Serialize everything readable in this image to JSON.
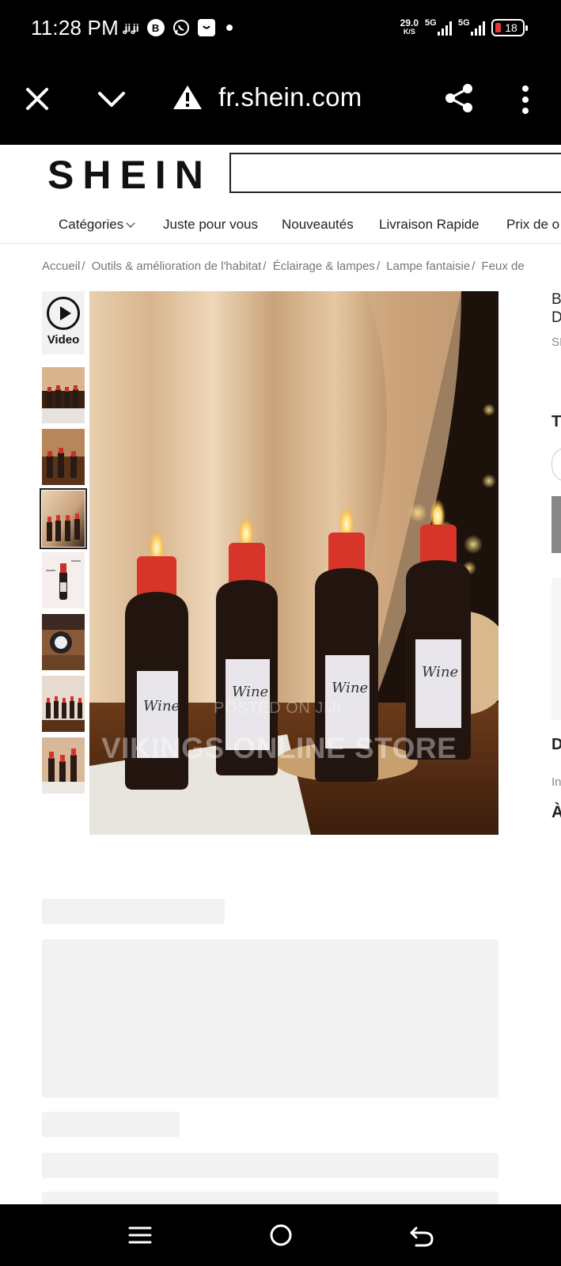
{
  "status_bar": {
    "time": "11:28 PM",
    "net_speed": "29.0",
    "net_unit": "K/S",
    "sim1": "5G",
    "sim2": "5G",
    "battery": "18"
  },
  "browser": {
    "url": "fr.shein.com",
    "icons": [
      "close-icon",
      "chevron-down-icon",
      "warning-icon",
      "share-icon",
      "more-vert-icon"
    ]
  },
  "site": {
    "logo": "SHEIN",
    "search_placeholder": ""
  },
  "nav": {
    "items": [
      "Catégories",
      "Juste pour vous",
      "Nouveautés",
      "Livraison Rapide",
      "Prix de o"
    ]
  },
  "breadcrumb": [
    "Accueil",
    "Outils & amélioration de l'habitat",
    "Éclairage & lampes",
    "Lampe fantaisie",
    "Feux de"
  ],
  "gallery": {
    "video_label": "Video",
    "thumb_count": 7,
    "active_thumb": 3
  },
  "watermark": {
    "line1": "POSTED ON JIJI",
    "line2": "VIKINGS ONLINE STORE"
  },
  "product_labels": {
    "bottle_label": "Wine"
  },
  "right_column": {
    "title_fragment_1": "B",
    "title_fragment_2": "D",
    "brand_fragment": "SI",
    "t_fragment": "T",
    "d_fragment": "D",
    "in_fragment": "In",
    "a_fragment": "À"
  }
}
